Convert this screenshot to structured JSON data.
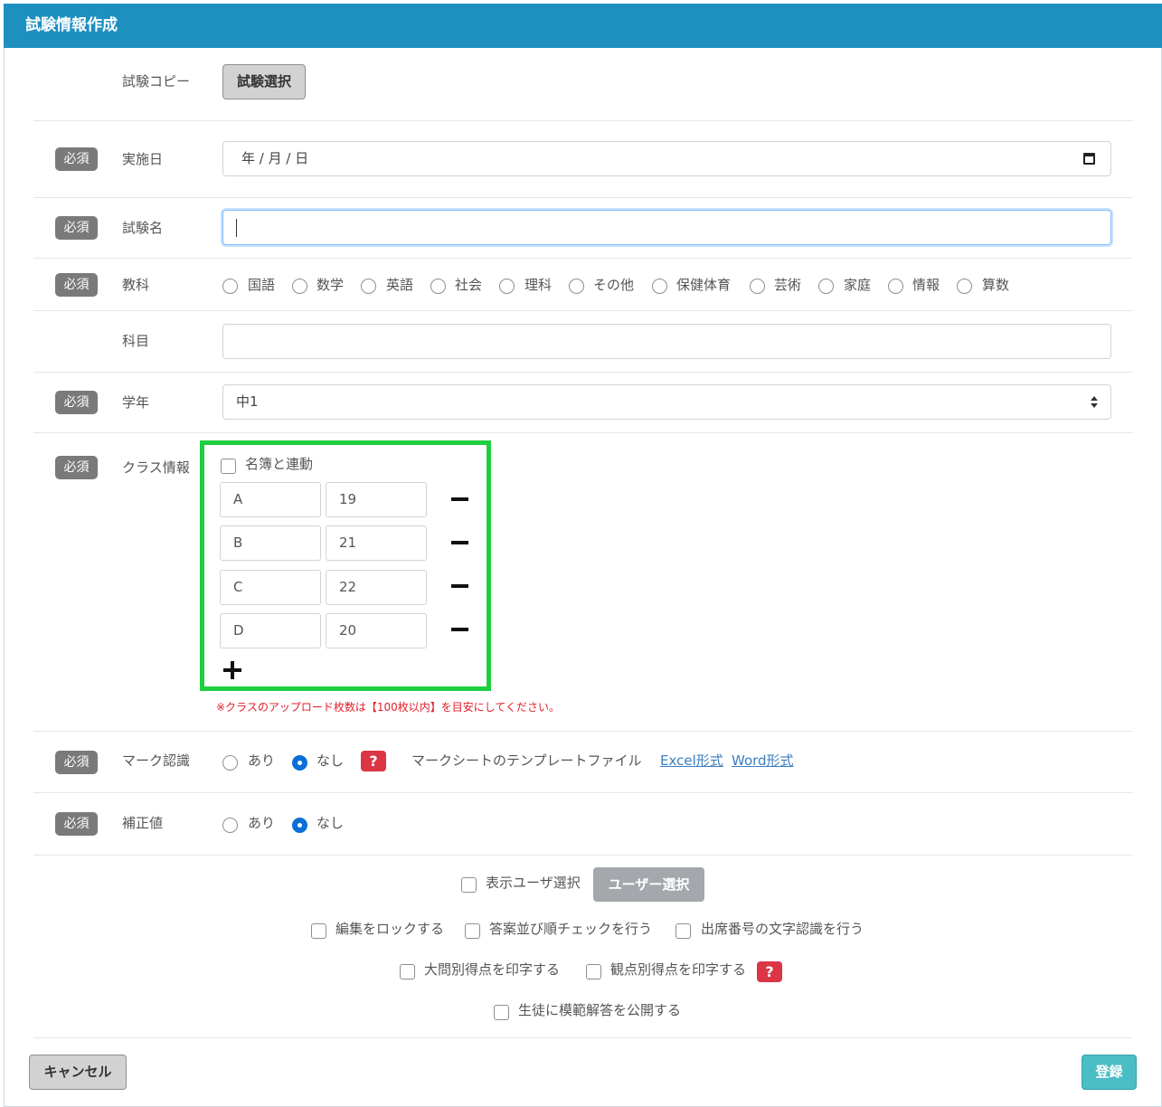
{
  "header": {
    "title": "試験情報作成"
  },
  "required_badge": "必須",
  "copy": {
    "label": "試験コピー",
    "button": "試験選択"
  },
  "date": {
    "label": "実施日",
    "value": "年 / 月 / 日"
  },
  "exam_name": {
    "label": "試験名",
    "value": ""
  },
  "subject": {
    "label": "教科",
    "options": [
      "国語",
      "数学",
      "英語",
      "社会",
      "理科",
      "その他",
      "保健体育",
      "芸術",
      "家庭",
      "情報",
      "算数"
    ]
  },
  "course": {
    "label": "科目",
    "value": ""
  },
  "grade": {
    "label": "学年",
    "value": "中1"
  },
  "class_info": {
    "label": "クラス情報",
    "link_roster": "名簿と連動",
    "rows": [
      {
        "name": "A",
        "count": "19"
      },
      {
        "name": "B",
        "count": "21"
      },
      {
        "name": "C",
        "count": "22"
      },
      {
        "name": "D",
        "count": "20"
      }
    ],
    "note": "※クラスのアップロード枚数は【100枚以内】を目安にしてください。"
  },
  "mark": {
    "label": "マーク認識",
    "yes": "あり",
    "no": "なし",
    "selected": "なし",
    "help": "?",
    "template_text": "マークシートのテンプレートファイル",
    "excel_link": "Excel形式",
    "word_link": "Word形式"
  },
  "correction": {
    "label": "補正値",
    "yes": "あり",
    "no": "なし",
    "selected": "なし"
  },
  "options": {
    "display_user": "表示ユーザ選択",
    "user_select_button": "ユーザー選択",
    "lock_edit": "編集をロックする",
    "answer_order_check": "答案並び順チェックを行う",
    "seat_number_ocr": "出席番号の文字認識を行う",
    "print_question_scores": "大問別得点を印字する",
    "print_viewpoint_scores": "観点別得点を印字する",
    "help": "?",
    "publish_model_answer": "生徒に模範解答を公開する"
  },
  "footer": {
    "cancel": "キャンセル",
    "register": "登録"
  },
  "colors": {
    "header": "#1e90c0",
    "highlight": "#1ecf3f",
    "help": "#dc3545",
    "register": "#4bbdc4"
  }
}
